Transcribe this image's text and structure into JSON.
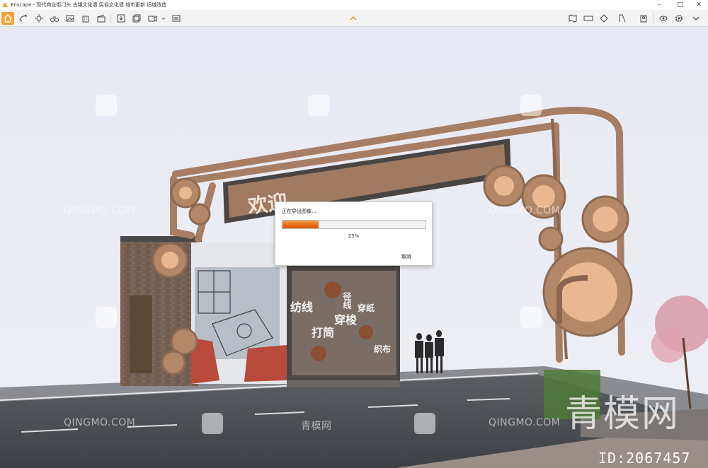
{
  "window": {
    "title": "Enscape - 现代商业街门头 古镇文化墙 民俗文化墙 城市更新 旧城改造",
    "controls": {
      "minimize": "–",
      "maximize": "□",
      "close": "✕"
    }
  },
  "toolbar": {
    "left_icons": [
      "home-icon",
      "sync-icon",
      "light-view-icon",
      "binoculars-icon",
      "image-icon",
      "building-icon",
      "clapper-icon",
      "export-image-icon",
      "batch-render-icon",
      "video-export-icon",
      "dropdown-icon"
    ],
    "center_icon": "chevron-up-icon",
    "right_icons": [
      "map-icon",
      "panorama-icon",
      "section-icon",
      "bookmark-icon",
      "asset-library-icon",
      "visual-settings-icon",
      "settings-icon"
    ],
    "accent_color": "#f2a33a"
  },
  "scene": {
    "sign_text": "欢迎",
    "wall_texts": [
      "纺线",
      "径线",
      "穿梭",
      "穿纸",
      "打简",
      "织布"
    ]
  },
  "dialog": {
    "title": "正在导出图像...",
    "progress": 0.25,
    "percent_label": "25%",
    "cancel_label": "取消",
    "progress_color": "#e46a12"
  },
  "watermarks": {
    "site_latin": "QINGMO.COM",
    "site_cn": "青模网",
    "brand": "青模网",
    "id_label": "ID:2067457"
  }
}
